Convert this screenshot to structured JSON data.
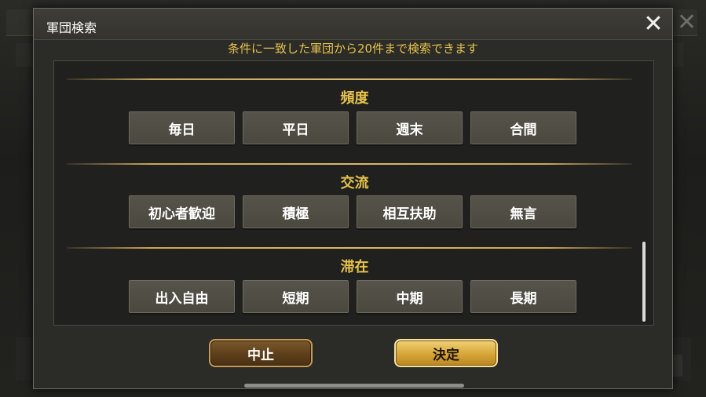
{
  "dialog": {
    "title": "軍団検索",
    "close_icon": "close-icon",
    "subtitle": "条件に一致した軍団から20件まで検索できます"
  },
  "sections": [
    {
      "title": "頻度",
      "options": [
        "毎日",
        "平日",
        "週末",
        "合間"
      ]
    },
    {
      "title": "交流",
      "options": [
        "初心者歓迎",
        "積極",
        "相互扶助",
        "無言"
      ]
    },
    {
      "title": "滞在",
      "options": [
        "出入自由",
        "短期",
        "中期",
        "長期"
      ]
    }
  ],
  "actions": {
    "cancel_label": "中止",
    "ok_label": "決定"
  },
  "colors": {
    "accent_gold": "#e7c34c",
    "panel_bg": "#20201e",
    "option_bg": "#4a483f"
  }
}
